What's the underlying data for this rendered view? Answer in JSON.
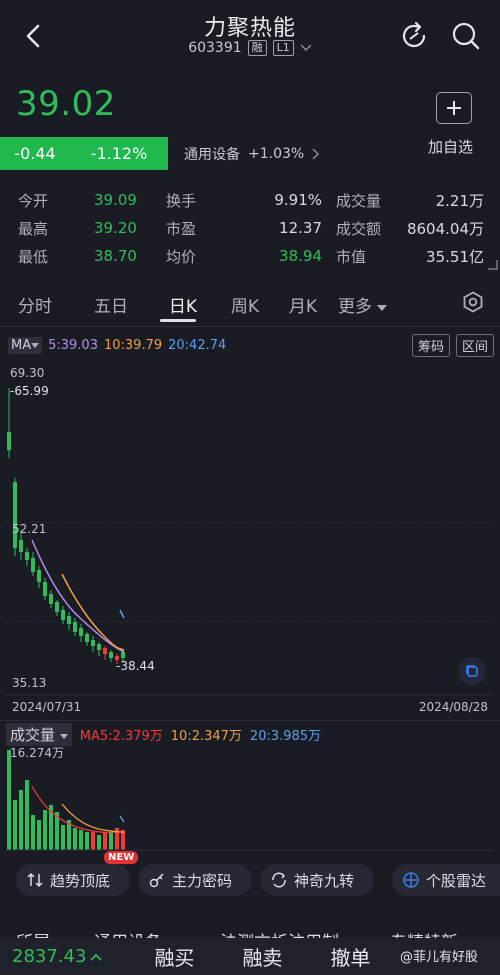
{
  "header": {
    "title": "力聚热能",
    "code": "603391",
    "tag_rong": "融",
    "tag_level": "L1"
  },
  "quote": {
    "price": "39.02",
    "change": "-0.44",
    "change_pct": "-1.12%",
    "industry": "通用设备",
    "industry_pct": "+1.03%",
    "add_label": "加自选"
  },
  "stats": [
    [
      "今开",
      "39.09",
      "换手",
      "9.91%",
      "成交量",
      "2.21万"
    ],
    [
      "最高",
      "39.20",
      "市盈",
      "12.37",
      "成交额",
      "8604.04万"
    ],
    [
      "最低",
      "38.70",
      "均价",
      "38.94",
      "市值",
      "35.51亿"
    ]
  ],
  "tabs": [
    "分时",
    "五日",
    "日K",
    "周K",
    "月K",
    "更多"
  ],
  "ma": {
    "label": "MA",
    "ma5": "5:39.03",
    "ma10": "10:39.79",
    "ma20": "20:42.74",
    "btn_chips": "筹码",
    "btn_range": "区间"
  },
  "kline": {
    "top_label": "69.30",
    "high_label": "65.99",
    "mid_label": "52.21",
    "low_label": "35.13",
    "last_label": "38.44",
    "date_start": "2024/07/31",
    "date_end": "2024/08/28"
  },
  "volume": {
    "label": "成交量",
    "ma5": "MA5:2.379万",
    "ma10": "10:2.347万",
    "ma20": "20:3.985万",
    "max_label": "16.274万",
    "new_badge": "NEW"
  },
  "chips": [
    "趋势顶底",
    "主力密码",
    "神奇九转",
    "个股雷达"
  ],
  "news_partial": [
    "所属",
    "通用设备",
    "法测文析注用制",
    "专精特新"
  ],
  "bottom": {
    "index_value": "2837.43",
    "btn_margin_buy": "融买",
    "btn_margin_sell": "融卖",
    "btn_cancel": "撤单",
    "watermark": "@菲儿有好股"
  },
  "colors": {
    "up": "#f03a3a",
    "down": "#2ebd5a",
    "ma5": "#b58cf0",
    "ma10": "#f0a040",
    "ma20": "#5aa0f0",
    "bg": "#1a1c24"
  }
}
